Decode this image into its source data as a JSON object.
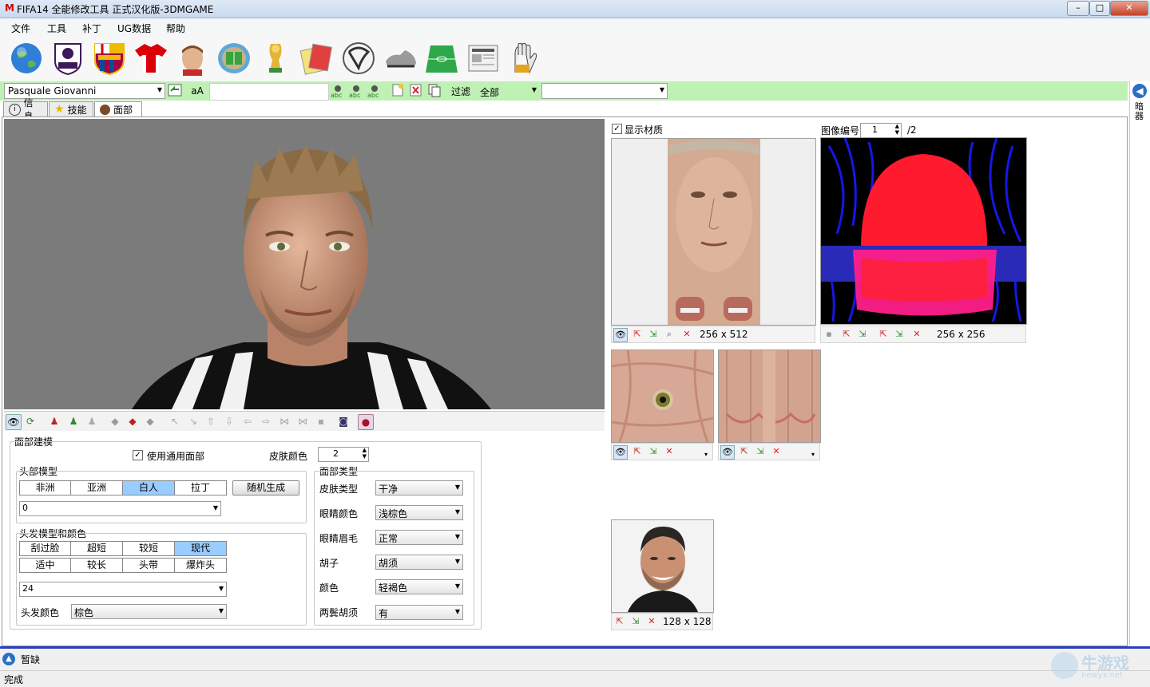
{
  "window": {
    "title": "FIFA14 全能修改工具 正式汉化版-3DMGAME",
    "app_icon": "M",
    "controls": {
      "minimize": "–",
      "maximize": "□",
      "close": "✕"
    }
  },
  "menu": [
    "文件",
    "工具",
    "补丁",
    "UG数据",
    "帮助"
  ],
  "toolbar_icons": [
    "globe-icon",
    "premier-league-icon",
    "fc-barcelona-icon",
    "jersey-icon",
    "player-head-icon",
    "stadium-icon",
    "trophy-icon",
    "cards-icon",
    "ball-icon",
    "boot-icon",
    "pitch-icon",
    "newspaper-icon",
    "glove-icon"
  ],
  "search": {
    "player_name": "Pasquale Giovanni",
    "case_button": "aA",
    "filter_label": "过滤",
    "filter_value": "全部",
    "second_combo_value": ""
  },
  "tabs": [
    "信息",
    "技能",
    "面部"
  ],
  "face_modeling": {
    "section_title": "面部建模",
    "use_generic_face": "使用通用面部",
    "use_generic_face_checked": true,
    "skin_color_label": "皮肤颜色",
    "skin_color_value": "2",
    "head_model": {
      "title": "头部模型",
      "options": [
        "非洲",
        "亚洲",
        "白人",
        "拉丁"
      ],
      "selected": "白人",
      "random_button": "随机生成",
      "model_value": "0"
    },
    "hair": {
      "title": "头发模型和颜色",
      "row1": [
        "刮过脸",
        "超短",
        "较短",
        "现代"
      ],
      "row2": [
        "适中",
        "较长",
        "头带",
        "爆炸头"
      ],
      "selected": "现代",
      "model_value": "24",
      "color_label": "头发颜色",
      "color_value": "棕色"
    },
    "face_type": {
      "title": "面部类型",
      "fields": [
        {
          "label": "皮肤类型",
          "value": "干净"
        },
        {
          "label": "眼睛颜色",
          "value": "浅棕色"
        },
        {
          "label": "眼睛眉毛",
          "value": "正常"
        },
        {
          "label": "胡子",
          "value": "胡须"
        },
        {
          "label": "颜色",
          "value": "轻褐色"
        },
        {
          "label": "两鬓胡须",
          "value": "有"
        }
      ]
    }
  },
  "textures": {
    "show_texture_label": "显示材质",
    "show_texture_checked": true,
    "image_number_label": "图像编号",
    "image_number_value": "1",
    "image_number_total": "/2",
    "face_texture_size": "256 x 512",
    "hair_texture_size": "256 x 256",
    "photo_size": "128 x 128"
  },
  "side_panel_text": "暗器",
  "bottom": {
    "label": "暂缺"
  },
  "status": "完成",
  "watermark": {
    "main": "牛游戏",
    "sub": "newyx.net"
  },
  "colors": {
    "search_row_bg": "#bff0b4",
    "selected_segment": "#99ccff",
    "bottom_accent": "#2b3fbf"
  }
}
